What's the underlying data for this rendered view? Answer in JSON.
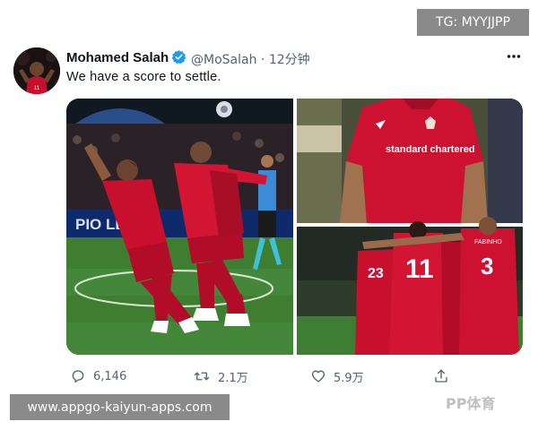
{
  "overlay": {
    "top_right_label": "TG: MYYJJPP",
    "bottom_left_label": "www.appgo-kaiyun-apps.com"
  },
  "tweet": {
    "author_name": "Mohamed Salah",
    "handle": "@MoSalah",
    "separator": "·",
    "time": "12分钟",
    "text": "We have a score to settle.",
    "more_icon": "more-horizontal-icon",
    "media": {
      "photos": [
        {
          "position": "left",
          "description_icon": "photo"
        },
        {
          "position": "top-right",
          "description_icon": "photo"
        },
        {
          "position": "bottom-right",
          "description_icon": "photo"
        }
      ],
      "printed_text": {
        "sponsor_top": "standard chartered",
        "banner": "PIO LEAGU",
        "shirt_number_a": "11",
        "shirt_number_b": "3",
        "shirt_number_c": "23",
        "shirt_name_b": "FABINHO"
      }
    },
    "actions": {
      "reply_count": "6,146",
      "retweet_count": "2.1万",
      "like_count": "5.9万"
    }
  },
  "watermark": "PP体育",
  "colors": {
    "verified": "#1d9bf0",
    "liverpool_red": "#c8102e",
    "pitch_green": "#3a7a2e"
  }
}
